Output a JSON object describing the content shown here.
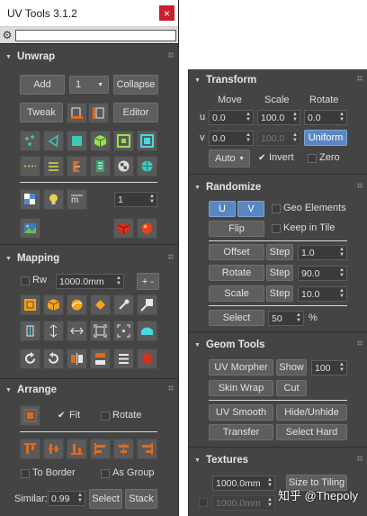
{
  "window": {
    "title": "UV Tools 3.1.2",
    "close": "×"
  },
  "unwrap": {
    "title": "Unwrap",
    "add": "Add",
    "channel": "1",
    "collapse": "Collapse",
    "tweak": "Tweak",
    "editor": "Editor",
    "smooth_value": "1"
  },
  "mapping": {
    "title": "Mapping",
    "rw": "Rw",
    "size": "1000.0mm",
    "plusminus": "+ -"
  },
  "arrange": {
    "title": "Arrange",
    "fit": "Fit",
    "rotate": "Rotate",
    "to_border": "To Border",
    "as_group": "As Group",
    "similar": "Similar:",
    "similar_value": "0.99",
    "select": "Select",
    "stack": "Stack"
  },
  "transform": {
    "title": "Transform",
    "move": "Move",
    "scale": "Scale",
    "rotate": "Rotate",
    "u": "u",
    "v": "v",
    "u_move": "0.0",
    "u_scale": "100.0",
    "u_rotate": "0.0",
    "v_move": "0.0",
    "v_scale": "100.0",
    "uniform": "Uniform",
    "auto": "Auto",
    "invert": "Invert",
    "zero": "Zero"
  },
  "randomize": {
    "title": "Randomize",
    "u": "U",
    "v": "V",
    "geo_elements": "Geo Elements",
    "flip": "Flip",
    "keep_in_tile": "Keep in Tile",
    "offset": "Offset",
    "offset_step": "Step",
    "offset_value": "1.0",
    "rotate": "Rotate",
    "rotate_step": "Step",
    "rotate_value": "90.0",
    "scale": "Scale",
    "scale_step": "Step",
    "scale_value": "10.0",
    "select": "Select",
    "select_value": "50",
    "percent": "%"
  },
  "geom_tools": {
    "title": "Geom Tools",
    "uv_morpher": "UV Morpher",
    "show": "Show",
    "show_value": "100",
    "skin_wrap": "Skin Wrap",
    "cut": "Cut",
    "uv_smooth": "UV Smooth",
    "hide_unhide": "Hide/Unhide",
    "transfer": "Transfer",
    "select_hard": "Select Hard"
  },
  "textures": {
    "title": "Textures",
    "size": "1000.0mm",
    "size_to_tiling": "Size to Tiling",
    "size2": "1000.0mm"
  },
  "watermark": "知乎 @Thepoly"
}
